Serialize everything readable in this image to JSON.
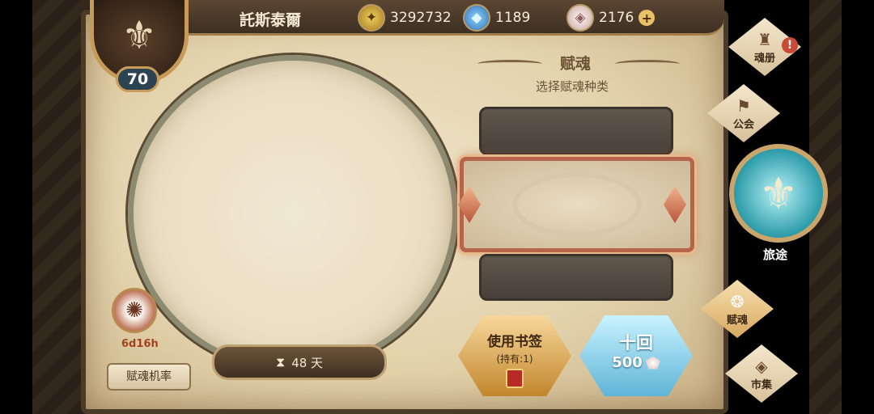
{
  "player": {
    "name": "託斯泰爾",
    "level": "70"
  },
  "resources": {
    "gold": "3292732",
    "crystal": "1189",
    "gem": "2176",
    "add": "+"
  },
  "portrait": {
    "time_left": "48 天"
  },
  "spirit": {
    "timer": "6d16h"
  },
  "rate_button": "赋魂机率",
  "panel": {
    "title": "赋魂",
    "subtitle": "选择赋魂种类"
  },
  "actions": {
    "bookmark": {
      "label": "使用书签",
      "held": "(持有:1)"
    },
    "ten": {
      "label": "十回",
      "cost": "500"
    }
  },
  "nav": {
    "soulbook": "魂册",
    "guild": "公会",
    "journey": "旅途",
    "soul": "赋魂",
    "market": "市集",
    "alert": "!"
  },
  "icons": {
    "gold": "gold-coin-icon",
    "crystal": "blue-crystal-icon",
    "gem": "pink-gem-icon",
    "hourglass": "hourglass-icon"
  }
}
